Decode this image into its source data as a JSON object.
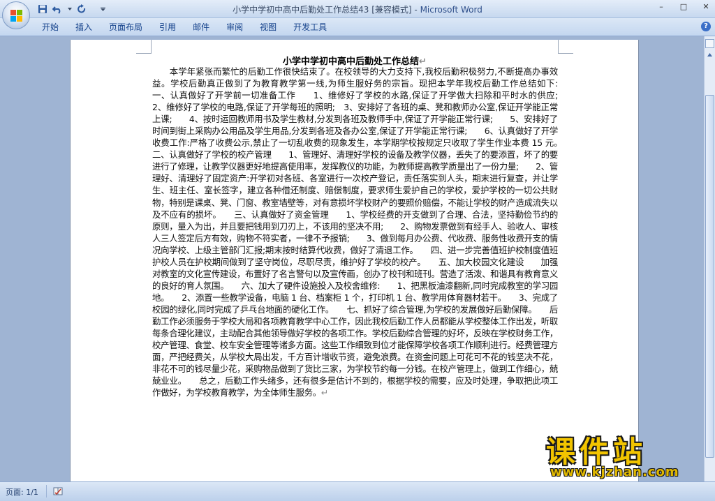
{
  "window": {
    "title_doc": "小学中学初中高中后勤处工作总结43 [兼容模式]",
    "title_sep": " - ",
    "title_app": "Microsoft Word",
    "minimize": "–",
    "maximize": "□",
    "close": "✕"
  },
  "ribbon": {
    "tabs": [
      "开始",
      "插入",
      "页面布局",
      "引用",
      "邮件",
      "审阅",
      "视图",
      "开发工具"
    ],
    "help": "?"
  },
  "document": {
    "title": "小学中学初中高中后勤处工作总结",
    "title_mark": "↵",
    "body": "本学年紧张而繁忙的后勤工作很快结束了。在校领导的大力支持下,我校后勤积极努力,不断提高办事效益。学校后勤真正做到了为教育教学第一线,为师生服好务的宗旨。现把本学年我校后勤工作总结如下:　　一、认真做好了开学前一切准备工作　　1、维修好了学校的水路,保证了开学做大扫除和平时水的供应;　　2、维修好了学校的电路,保证了开学每班的照明;　3、安排好了各班的桌、凳和教师办公室,保证开学能正常上课;　　4、按时运回教师用书及学生教材,分发到各班及教师手中,保证了开学能正常行课;　　5、安排好了时间到街上采购办公用品及学生用品,分发到各班及各办公室,保证了开学能正常行课;　　6、认真做好了开学收费工作:严格了收费公示,禁止了一切乱收费的现象发生，本学期学校按规定只收取了学生作业本费 15 元。　　二、认真做好了学校的校产管理　　1、管理好、清理好学校的设备及教学仪器，丢失了的要添置，坏了的要进行了修理，让教学仪器更好地提高使用率，发挥教仪的功能，为教师提高教学质量出了一份力量;　　2、管理好、清理好了固定资产:开学初对各班、各室进行一次校产登记，责任落实到人头，期末进行复查，并让学生、班主任、室长签字，建立各种借还制度、赔偿制度，要求师生爱护自己的学校，爱护学校的一切公共财物，特别是课桌、凳、门窗、教室墙壁等，对有意损坏学校财产的要照价赔偿，不能让学校的财产造成流失以及不应有的损坏。　　三、认真做好了资金管理　　1、学校经费的开支做到了合理、合法，坚持勤俭节约的原则，量入为出，并且要把钱用到刀刃上，不该用的坚决不用;　　2、购物发票做到有经手人、验收人、审核人三人签定后方有效，购物不符实者，一律不予报销;　　3、做到每月办公费、代收费、服务性收费开支的情况向学校、上级主管部门汇报;期末按时结算代收费，做好了清退工作。　　四、进一步完善值班护校制度值班护校人员在护校期间做到了坚守岗位，尽职尽责，维护好了学校的校产。　　五、加大校园文化建设　　加强对教室的文化宣传建设，布置好了名言警句以及宣传画，创办了校刊和班刊。营造了活泼、和谐具有教育意义的良好的育人氛围。　　六、加大了硬件设施投入及校舍维修:　　1、把黑板油漆翻新,同时完成教室的学习园地。　　2、添置一些教学设备，电脑 1 台、档案柜 1 个，打印机 1 台、教学用体育器材若干。　　3、完成了校园的绿化,同时完成了乒乓台地面的硬化工作。　　七、抓好了综合管理,为学校的发展做好后勤保障。　　后勤工作必须服务于学校大局和各项教育教学中心工作，因此我校后勤工作人员都能从学校整体工作出发，听取每条合理化建议，主动配合其他领导做好学校的各项工作。学校后勤综合管理的好坏，反映在学校财务工作，校产管理、食堂、校车安全管理等诸多方面。这些工作细致到位才能保障学校各项工作顺利进行。经费管理方面，严把经费关，从学校大局出发，千方百计增收节资，避免浪费。在资金问题上可花可不花的钱坚决不花，非花不可的钱尽量少花，采购物品做到了货比三家，为学校节约每一分钱。在校产管理上，做到工作细心，兢兢业业。　　总之，后勤工作头绪多，还有很多是估计不到的，根据学校的需要，应及时处理，争取把此项工作做好，为学校教育教学，为全体师生服务。",
    "body_mark": "↵"
  },
  "watermark": {
    "text": "课件站",
    "url": "www.kjzhan.com"
  },
  "status": {
    "page": "页面: 1/1"
  },
  "colors": {
    "accent": "#15428b",
    "watermark": "#f2c400"
  }
}
